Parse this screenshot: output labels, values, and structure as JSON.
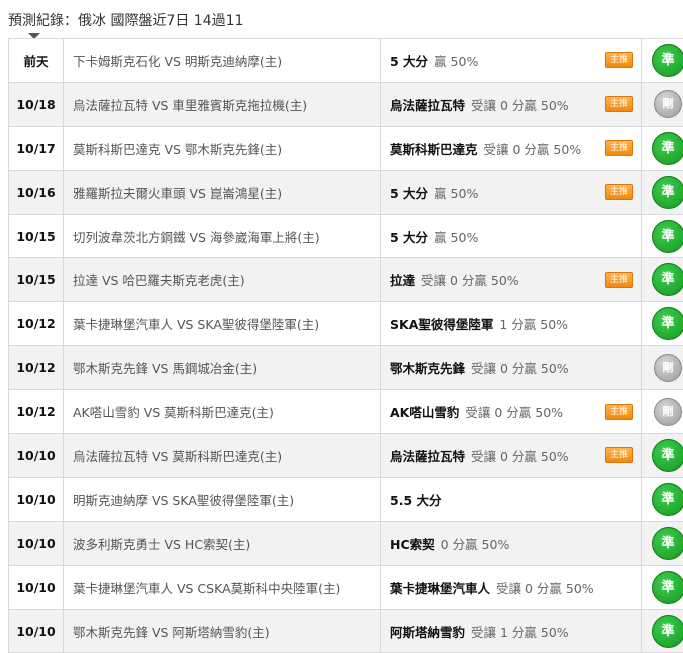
{
  "header": {
    "title": "預測紀錄：俄冰 國際盤近7日 14過11"
  },
  "colors": {
    "win_badge": "#1fae2c",
    "void_badge": "#b3b3b3",
    "tag": "#f39a1c",
    "alt_row": "#f2f2f2"
  },
  "rows": [
    {
      "date": "前天",
      "match": "下卡姆斯克石化 VS 明斯克迪納摩(主)",
      "team": "5 大分",
      "detail": "贏 50%",
      "tag": "主推",
      "result": "準",
      "status": "win"
    },
    {
      "date": "10/18",
      "match": "烏法薩拉瓦特 VS 車里雅賓斯克拖拉機(主)",
      "team": "烏法薩拉瓦特",
      "detail": "受讓 0 分贏 50%",
      "tag": "主推",
      "result": "剛",
      "status": "void"
    },
    {
      "date": "10/17",
      "match": "莫斯科斯巴達克 VS 鄂木斯克先鋒(主)",
      "team": "莫斯科斯巴達克",
      "detail": "受讓 0 分贏 50%",
      "tag": "主推",
      "result": "準",
      "status": "win"
    },
    {
      "date": "10/16",
      "match": "雅羅斯拉夫爾火車頭 VS 崑崙鴻星(主)",
      "team": "5 大分",
      "detail": "贏 50%",
      "tag": "主推",
      "result": "準",
      "status": "win"
    },
    {
      "date": "10/15",
      "match": "切列波韋茨北方鋼鐵 VS 海參崴海軍上將(主)",
      "team": "5 大分",
      "detail": "贏 50%",
      "tag": "",
      "result": "準",
      "status": "win"
    },
    {
      "date": "10/15",
      "match": "拉達 VS 哈巴羅夫斯克老虎(主)",
      "team": "拉達",
      "detail": "受讓 0 分贏 50%",
      "tag": "主推",
      "result": "準",
      "status": "win"
    },
    {
      "date": "10/12",
      "match": "葉卡捷琳堡汽車人 VS SKA聖彼得堡陸軍(主)",
      "team": "SKA聖彼得堡陸軍",
      "detail": "1 分贏 50%",
      "tag": "",
      "result": "準",
      "status": "win"
    },
    {
      "date": "10/12",
      "match": "鄂木斯克先鋒 VS 馬鋼城冶金(主)",
      "team": "鄂木斯克先鋒",
      "detail": "受讓 0 分贏 50%",
      "tag": "",
      "result": "剛",
      "status": "void"
    },
    {
      "date": "10/12",
      "match": "AK嗒山雪豹 VS 莫斯科斯巴達克(主)",
      "team": "AK嗒山雪豹",
      "detail": "受讓 0 分贏 50%",
      "tag": "主推",
      "result": "剛",
      "status": "void"
    },
    {
      "date": "10/10",
      "match": "烏法薩拉瓦特 VS 莫斯科斯巴達克(主)",
      "team": "烏法薩拉瓦特",
      "detail": "受讓 0 分贏 50%",
      "tag": "主推",
      "result": "準",
      "status": "win"
    },
    {
      "date": "10/10",
      "match": "明斯克迪納摩 VS SKA聖彼得堡陸軍(主)",
      "team": "5.5 大分",
      "detail": "",
      "tag": "",
      "result": "準",
      "status": "win"
    },
    {
      "date": "10/10",
      "match": "波多利斯克勇士 VS HC索契(主)",
      "team": "HC索契",
      "detail": "0 分贏 50%",
      "tag": "",
      "result": "準",
      "status": "win"
    },
    {
      "date": "10/10",
      "match": "葉卡捷琳堡汽車人 VS CSKA莫斯科中央陸軍(主)",
      "team": "葉卡捷琳堡汽車人",
      "detail": "受讓 0 分贏 50%",
      "tag": "",
      "result": "準",
      "status": "win"
    },
    {
      "date": "10/10",
      "match": "鄂木斯克先鋒 VS 阿斯塔納雪豹(主)",
      "team": "阿斯塔納雪豹",
      "detail": "受讓 1 分贏 50%",
      "tag": "",
      "result": "準",
      "status": "win"
    }
  ]
}
